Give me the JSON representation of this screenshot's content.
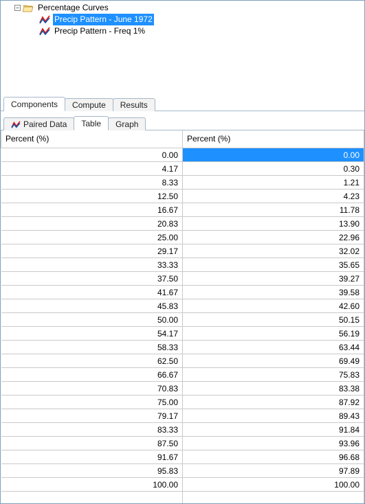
{
  "tree": {
    "root": {
      "label": "Percentage Curves",
      "expanded": true,
      "icon": "folder-open"
    },
    "items": [
      {
        "label": "Precip Pattern - June 1972",
        "selected": true
      },
      {
        "label": "Precip  Pattern - Freq 1%",
        "selected": false
      }
    ]
  },
  "main_tabs": {
    "items": [
      {
        "label": "Components"
      },
      {
        "label": "Compute"
      },
      {
        "label": "Results"
      }
    ],
    "active": 0
  },
  "sub_tabs": {
    "items": [
      {
        "label": "Paired Data",
        "icon": true
      },
      {
        "label": "Table"
      },
      {
        "label": "Graph"
      }
    ],
    "active": 1
  },
  "table": {
    "headers": {
      "a": "Percent (%)",
      "b": "Percent (%)"
    },
    "selected_row": 0,
    "rows": [
      {
        "a": "0.00",
        "b": "0.00"
      },
      {
        "a": "4.17",
        "b": "0.30"
      },
      {
        "a": "8.33",
        "b": "1.21"
      },
      {
        "a": "12.50",
        "b": "4.23"
      },
      {
        "a": "16.67",
        "b": "11.78"
      },
      {
        "a": "20.83",
        "b": "13.90"
      },
      {
        "a": "25.00",
        "b": "22.96"
      },
      {
        "a": "29.17",
        "b": "32.02"
      },
      {
        "a": "33.33",
        "b": "35.65"
      },
      {
        "a": "37.50",
        "b": "39.27"
      },
      {
        "a": "41.67",
        "b": "39.58"
      },
      {
        "a": "45.83",
        "b": "42.60"
      },
      {
        "a": "50.00",
        "b": "50.15"
      },
      {
        "a": "54.17",
        "b": "56.19"
      },
      {
        "a": "58.33",
        "b": "63.44"
      },
      {
        "a": "62.50",
        "b": "69.49"
      },
      {
        "a": "66.67",
        "b": "75.83"
      },
      {
        "a": "70.83",
        "b": "83.38"
      },
      {
        "a": "75.00",
        "b": "87.92"
      },
      {
        "a": "79.17",
        "b": "89.43"
      },
      {
        "a": "83.33",
        "b": "91.84"
      },
      {
        "a": "87.50",
        "b": "93.96"
      },
      {
        "a": "91.67",
        "b": "96.68"
      },
      {
        "a": "95.83",
        "b": "97.89"
      },
      {
        "a": "100.00",
        "b": "100.00"
      }
    ]
  },
  "chart_data": {
    "type": "table",
    "title": "Precip Pattern - June 1972",
    "columns": [
      "Percent (%)",
      "Percent (%)"
    ],
    "x": [
      0.0,
      4.17,
      8.33,
      12.5,
      16.67,
      20.83,
      25.0,
      29.17,
      33.33,
      37.5,
      41.67,
      45.83,
      50.0,
      54.17,
      58.33,
      62.5,
      66.67,
      70.83,
      75.0,
      79.17,
      83.33,
      87.5,
      91.67,
      95.83,
      100.0
    ],
    "y": [
      0.0,
      0.3,
      1.21,
      4.23,
      11.78,
      13.9,
      22.96,
      32.02,
      35.65,
      39.27,
      39.58,
      42.6,
      50.15,
      56.19,
      63.44,
      69.49,
      75.83,
      83.38,
      87.92,
      89.43,
      91.84,
      93.96,
      96.68,
      97.89,
      100.0
    ],
    "xlabel": "Percent (%)",
    "ylabel": "Percent (%)",
    "xlim": [
      0,
      100
    ],
    "ylim": [
      0,
      100
    ]
  }
}
